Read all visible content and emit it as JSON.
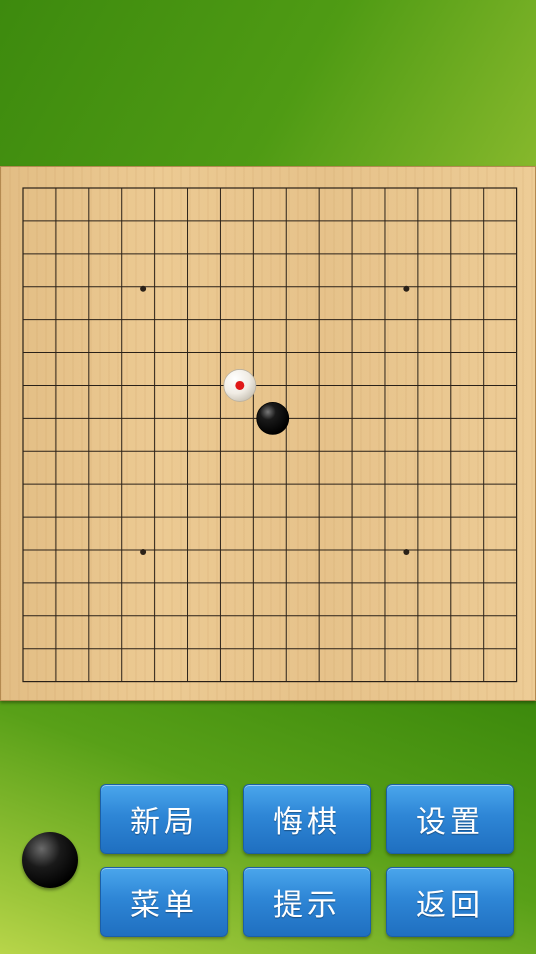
{
  "board": {
    "size": 15,
    "star_points": [
      [
        3,
        3
      ],
      [
        11,
        3
      ],
      [
        3,
        11
      ],
      [
        11,
        11
      ]
    ],
    "stones": [
      {
        "color": "white",
        "col": 6,
        "row": 6,
        "last_move": true
      },
      {
        "color": "black",
        "col": 7,
        "row": 7,
        "last_move": false
      }
    ],
    "colors": {
      "wood": "#e8c48c",
      "line": "#2a2118",
      "last_move_marker": "#e01818"
    }
  },
  "current_turn": "black",
  "buttons": {
    "new_game": "新局",
    "undo": "悔棋",
    "settings": "设置",
    "menu": "菜单",
    "hint": "提示",
    "back": "返回"
  },
  "colors": {
    "button": "#2e86d6",
    "background": "#4d9a12"
  }
}
